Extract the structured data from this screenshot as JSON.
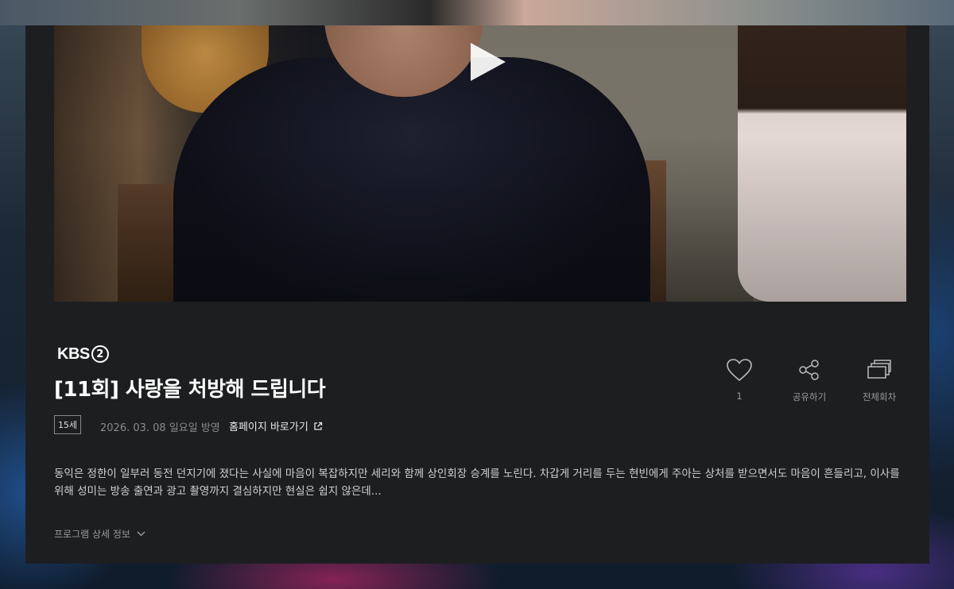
{
  "program": {
    "broadcaster_logo_text": "KBS",
    "broadcaster_logo_num": "2",
    "title": "[11회] 사랑을 처방해 드립니다",
    "rating": "15세",
    "air_date": "2026. 03. 08 일요일 방영",
    "homepage_link": "홈페이지 바로가기",
    "description": "동익은 정한이 일부러 동전 던지기에 졌다는 사실에 마음이 복잡하지만 세리와 함께 상인회장 승계를 노린다. 차갑게 거리를 두는 현빈에게 주아는 상처를 받으면서도 마음이 흔들리고, 이사를 위해 성미는 방송 출연과 광고 촬영까지 결심하지만 현실은 쉽지 않은데...",
    "detail_toggle": "프로그램 상세 정보"
  },
  "actions": {
    "like_count": "1",
    "share_label": "공유하기",
    "all_episodes_label": "전체회차"
  },
  "icons": {
    "play": "play-icon",
    "like": "heart-icon",
    "share": "share-icon",
    "episodes": "stack-icon",
    "external": "external-link-icon",
    "chevron": "chevron-down-icon"
  }
}
